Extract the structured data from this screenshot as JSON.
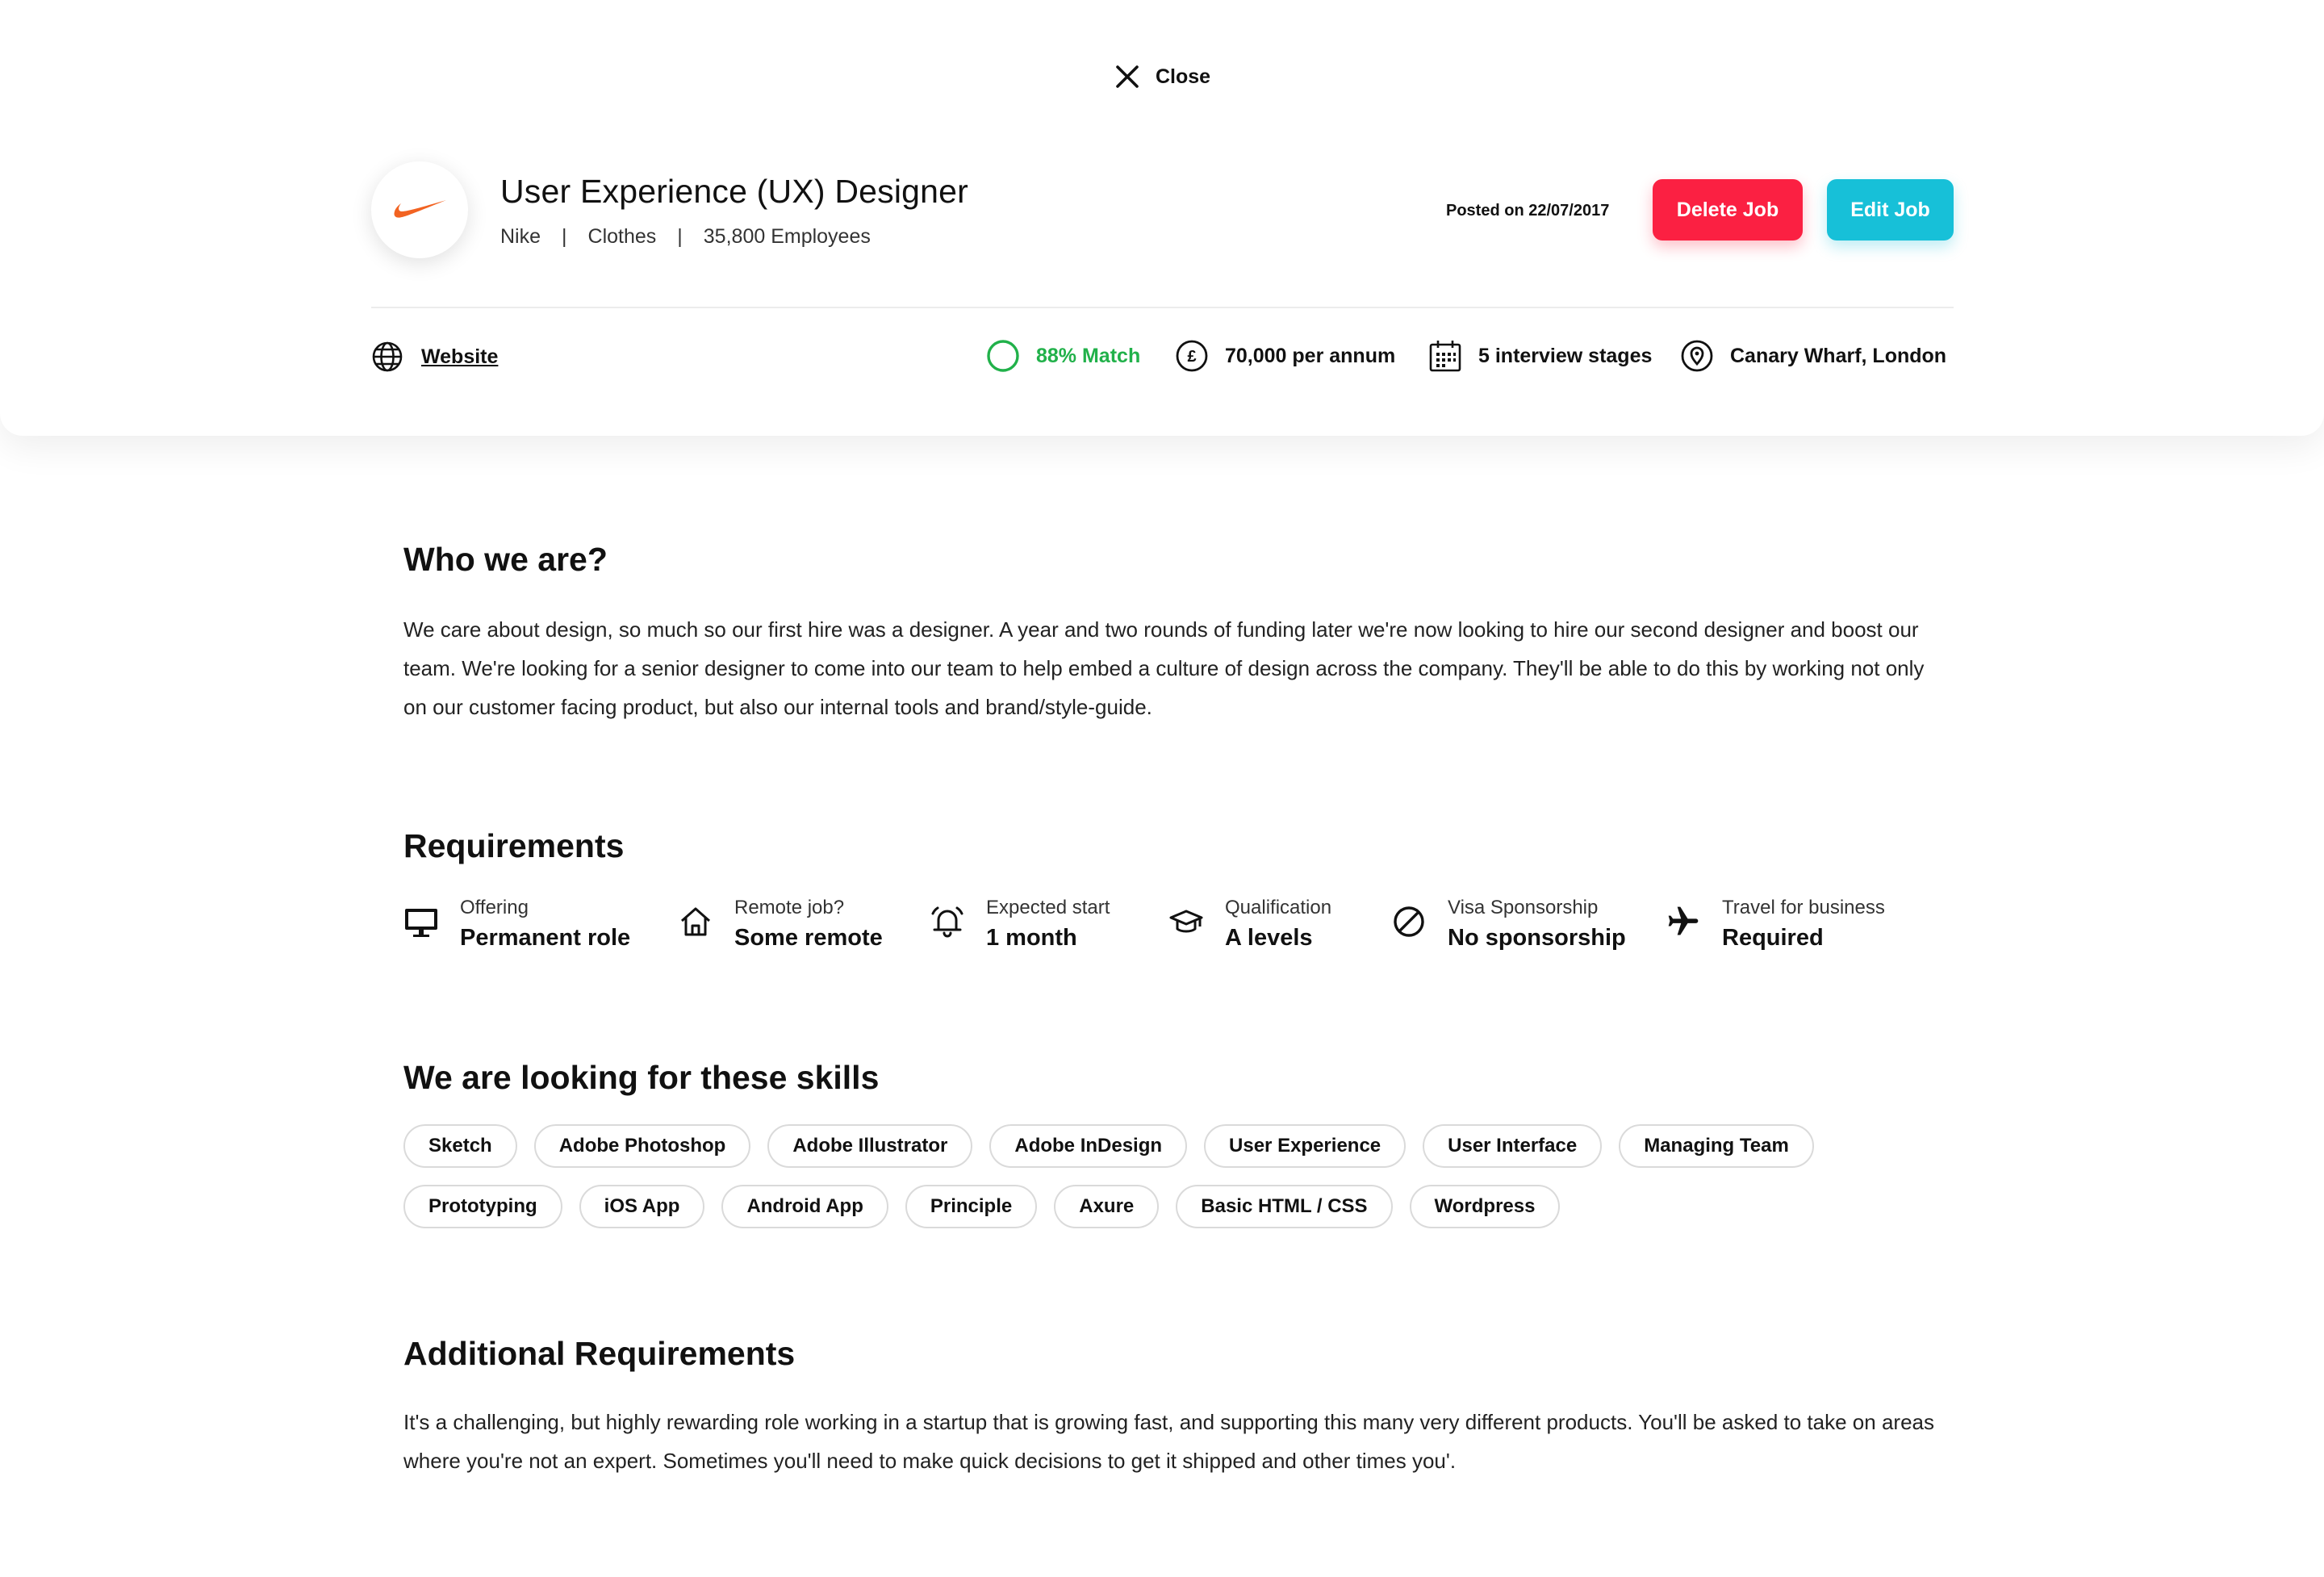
{
  "close_label": "Close",
  "job": {
    "title": "User Experience (UX) Designer",
    "company": "Nike",
    "industry": "Clothes",
    "employees": "35,800 Employees",
    "separator": "|",
    "posted": "Posted on 22/07/2017",
    "logo_icon": "nike-swoosh-icon"
  },
  "actions": {
    "delete_label": "Delete Job",
    "edit_label": "Edit Job"
  },
  "links": {
    "website_label": "Website"
  },
  "stats": {
    "match": "88% Match",
    "salary": "70,000 per annum",
    "stages": "5 interview stages",
    "location": "Canary Wharf, London"
  },
  "about": {
    "title": "Who we are?",
    "body": "We care about design, so much so our first hire was a designer. A year and two rounds of funding later we're now looking to hire our second designer and boost our team. We're looking for a senior designer to come into our team to help embed a culture of design across the company. They'll be able to do this by working not only on our customer facing product, but also our internal tools and brand/style-guide."
  },
  "requirements": {
    "title": "Requirements",
    "items": [
      {
        "label": "Offering",
        "value": "Permanent role",
        "icon": "monitor-icon"
      },
      {
        "label": "Remote job?",
        "value": "Some remote",
        "icon": "home-icon"
      },
      {
        "label": "Expected start",
        "value": "1 month",
        "icon": "alarm-icon"
      },
      {
        "label": "Qualification",
        "value": "A levels",
        "icon": "graduation-cap-icon"
      },
      {
        "label": "Visa Sponsorship",
        "value": "No sponsorship",
        "icon": "no-entry-icon"
      },
      {
        "label": "Travel for business",
        "value": "Required",
        "icon": "airplane-icon"
      }
    ]
  },
  "skills": {
    "title": "We are looking for these skills",
    "items": [
      "Sketch",
      "Adobe Photoshop",
      "Adobe Illustrator",
      "Adobe InDesign",
      "User Experience",
      "User Interface",
      "Managing Team",
      "Prototyping",
      "iOS App",
      "Android App",
      "Principle",
      "Axure",
      "Basic HTML / CSS",
      "Wordpress"
    ]
  },
  "additional": {
    "title": "Additional Requirements",
    "body": "It's a challenging, but highly rewarding role working in a startup that is growing fast, and supporting this many very different products. You'll be asked to take on areas where you're not an expert. Sometimes you'll need to make quick decisions to get it shipped and other times you'."
  },
  "colors": {
    "delete": "#fb2042",
    "edit": "#17c0d8",
    "match": "#21b14a",
    "nike": "#f26322"
  }
}
